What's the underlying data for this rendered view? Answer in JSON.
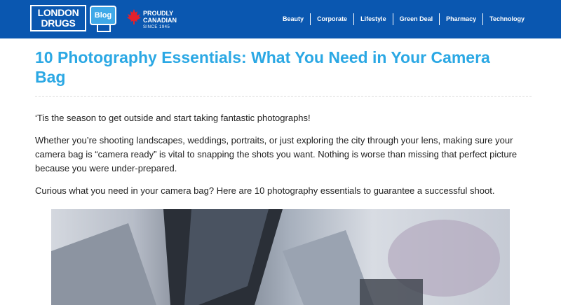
{
  "header": {
    "logo_line1": "LONDON",
    "logo_line2": "DRUGS",
    "blog_label": "Blog",
    "proudly_line1": "PROUDLY",
    "proudly_line2": "CANADIAN",
    "proudly_line3": "SINCE 1945",
    "brand_color": "#0a57b0",
    "nav": [
      {
        "label": "Beauty"
      },
      {
        "label": "Corporate"
      },
      {
        "label": "Lifestyle"
      },
      {
        "label": "Green Deal"
      },
      {
        "label": "Pharmacy"
      },
      {
        "label": "Technology"
      }
    ]
  },
  "article": {
    "title": "10 Photography Essentials: What You Need in Your Camera Bag",
    "title_color": "#2ba8e4",
    "paragraphs": [
      "‘Tis the season to get outside and start taking fantastic photographs!",
      "Whether you’re shooting landscapes, weddings, portraits, or just exploring the city through your lens, making sure your camera bag is “camera ready” is vital to snapping the shots you want. Nothing is worse than missing that perfect picture because you were under-prepared.",
      "Curious what you need in your camera bag? Here are 10 photography essentials to guarantee a successful shoot."
    ]
  },
  "icons": {
    "maple": "maple-leaf-icon"
  }
}
